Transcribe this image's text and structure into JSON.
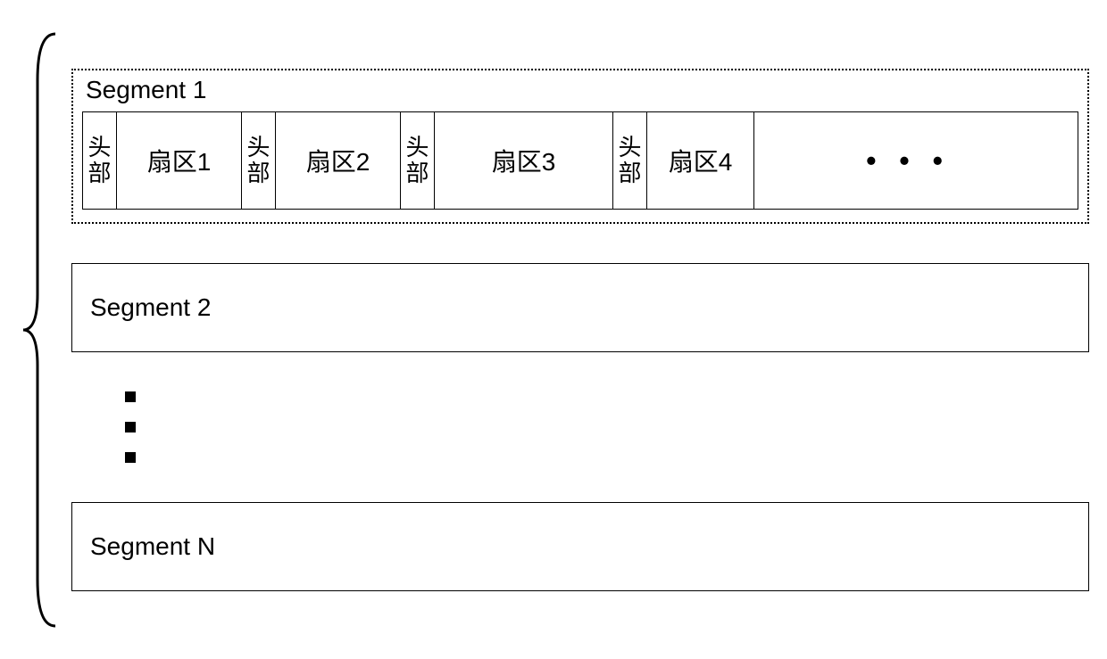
{
  "segment1": {
    "title": "Segment 1",
    "header_label": "头\n部",
    "sectors": [
      "扇区1",
      "扇区2",
      "扇区3",
      "扇区4"
    ],
    "ellipsis": "•••"
  },
  "segment2": {
    "label": "Segment 2"
  },
  "segmentN": {
    "label": "Segment N"
  }
}
